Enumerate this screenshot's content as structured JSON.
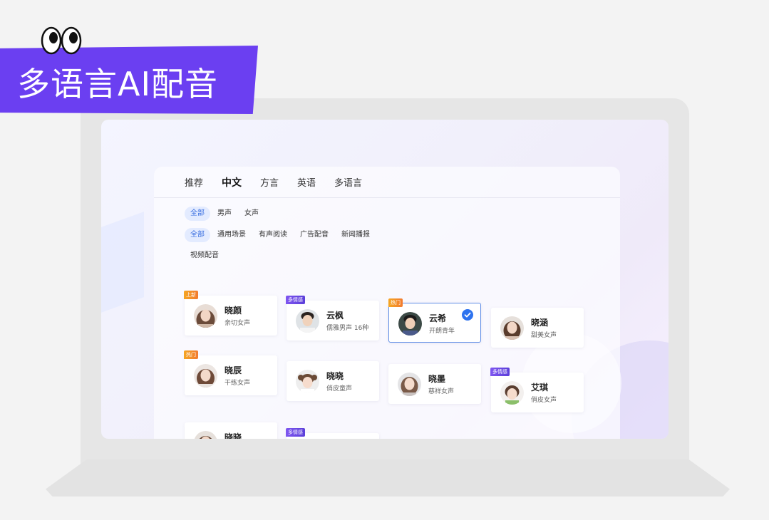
{
  "banner": {
    "title": "多语言AI配音"
  },
  "tabs": [
    {
      "label": "推荐",
      "active": false
    },
    {
      "label": "中文",
      "active": true
    },
    {
      "label": "方言",
      "active": false
    },
    {
      "label": "英语",
      "active": false
    },
    {
      "label": "多语言",
      "active": false
    }
  ],
  "gender_filters": [
    {
      "label": "全部",
      "selected": true
    },
    {
      "label": "男声",
      "selected": false
    },
    {
      "label": "女声",
      "selected": false
    }
  ],
  "scene_filters": [
    {
      "label": "全部",
      "selected": true
    },
    {
      "label": "通用场景",
      "selected": false
    },
    {
      "label": "有声阅读",
      "selected": false
    },
    {
      "label": "广告配音",
      "selected": false
    },
    {
      "label": "新闻播报",
      "selected": false
    },
    {
      "label": "视频配音",
      "selected": false
    }
  ],
  "voices": [
    {
      "name": "晓颜",
      "desc": "亲切女声",
      "badge": "上新",
      "badge_color": "orange",
      "selected": false,
      "avatar": "female"
    },
    {
      "name": "云枫",
      "desc": "儒雅男声 16种",
      "badge": "多情感",
      "badge_color": "purple",
      "selected": false,
      "avatar": "male"
    },
    {
      "name": "云希",
      "desc": "开朗青年",
      "badge": "热门",
      "badge_color": "orange",
      "selected": true,
      "avatar": "male"
    },
    {
      "name": "晓涵",
      "desc": "甜美女声",
      "badge": "",
      "badge_color": "",
      "selected": false,
      "avatar": "female"
    },
    {
      "name": "晓辰",
      "desc": "干练女声",
      "badge": "热门",
      "badge_color": "orange",
      "selected": false,
      "avatar": "female"
    },
    {
      "name": "晓晓",
      "desc": "俏皮童声",
      "badge": "",
      "badge_color": "",
      "selected": false,
      "avatar": "child"
    },
    {
      "name": "晓墨",
      "desc": "慈祥女声",
      "badge": "",
      "badge_color": "",
      "selected": false,
      "avatar": "female"
    },
    {
      "name": "艾琪",
      "desc": "俏皮女声",
      "badge": "多情感",
      "badge_color": "purple",
      "selected": false,
      "avatar": "child"
    },
    {
      "name": "晓晓",
      "desc": "",
      "badge": "",
      "badge_color": "",
      "selected": false,
      "avatar": "female"
    },
    {
      "name": "",
      "desc": "",
      "badge": "多情感",
      "badge_color": "purple",
      "selected": false,
      "avatar": ""
    }
  ],
  "colors": {
    "accent": "#2e73ef",
    "banner": "#6b3ff1",
    "badge_orange": "#f5a623",
    "badge_purple": "#6f4ae6"
  }
}
